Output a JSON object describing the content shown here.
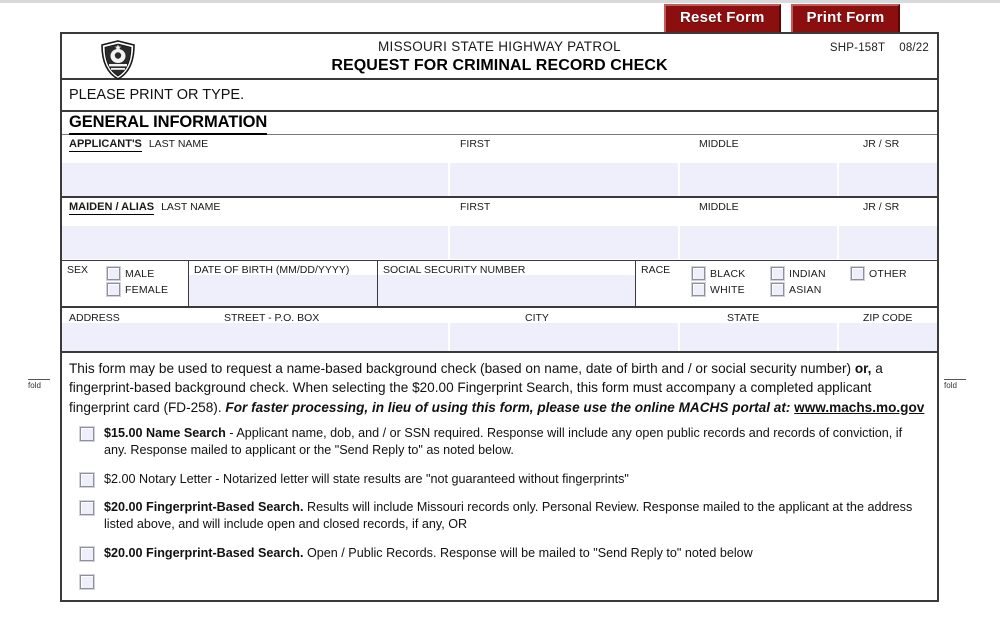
{
  "toolbar": {
    "reset_label": "Reset Form",
    "print_label": "Print Form",
    "button_color": "#8c0f10"
  },
  "header": {
    "seal_icon": "highway-patrol-shield-badge-icon",
    "organization": "MISSOURI STATE HIGHWAY PATROL",
    "title": "REQUEST FOR CRIMINAL RECORD CHECK",
    "form_number": "SHP-158T",
    "revision": "08/22"
  },
  "instructions_top": "PLEASE PRINT OR TYPE.",
  "general_information": {
    "section_title": "GENERAL INFORMATION",
    "applicant": {
      "owner_label": "APPLICANT'S",
      "last_name_label": "LAST NAME",
      "first_label": "FIRST",
      "middle_label": "MIDDLE",
      "suffix_label": "JR / SR",
      "last_name_value": "",
      "first_value": "",
      "middle_value": "",
      "suffix_value": ""
    },
    "maiden": {
      "owner_label": "MAIDEN / ALIAS",
      "last_name_label": "LAST NAME",
      "first_label": "FIRST",
      "middle_label": "MIDDLE",
      "suffix_label": "JR / SR",
      "last_name_value": "",
      "first_value": "",
      "middle_value": "",
      "suffix_value": ""
    },
    "sex": {
      "label": "SEX",
      "options": [
        "MALE",
        "FEMALE"
      ]
    },
    "dob": {
      "label": "DATE OF BIRTH (MM/DD/YYYY)",
      "value": ""
    },
    "ssn": {
      "label": "SOCIAL SECURITY NUMBER",
      "value": ""
    },
    "race": {
      "label": "RACE",
      "column1": [
        "BLACK",
        "WHITE"
      ],
      "column2": [
        "INDIAN",
        "ASIAN"
      ],
      "column3": [
        "OTHER"
      ]
    },
    "address": {
      "label": "ADDRESS",
      "street_label": "STREET - P.O. BOX",
      "city_label": "CITY",
      "state_label": "STATE",
      "zip_label": "ZIP CODE",
      "street_value": "",
      "city_value": "",
      "state_value": "",
      "zip_value": ""
    }
  },
  "fold_marks": {
    "left": "fold",
    "right": "fold"
  },
  "instructions": {
    "part1": "This form may be used to request a name-based background check (based on name, date of birth and / or social security number) ",
    "bold_or": "or,",
    "part2": " a fingerprint-based background check.  When selecting the $20.00 Fingerprint Search, this form must accompany a completed applicant fingerprint card (FD-258).  ",
    "italic": "For faster processing, in lieu of  using this form, please use the online MACHS portal at:  ",
    "link": "www.machs.mo.gov"
  },
  "options": [
    {
      "bold": "$15.00 Name Search",
      "rest": " - Applicant name, dob, and / or SSN required.  Response will include any open public records and records of conviction, if any.  Response mailed to applicant or the \"Send Reply to\" as noted below.",
      "checked": false
    },
    {
      "bold": "",
      "rest": "$2.00 Notary Letter - Notarized letter will state results are \"not guaranteed without fingerprints\"",
      "checked": false
    },
    {
      "bold": "$20.00 Fingerprint-Based Search.",
      "rest": "  Results will include Missouri records only.  Personal Review.  Response mailed to the applicant at the address listed above, and will include open and closed records, if any, OR",
      "checked": false
    },
    {
      "bold": "$20.00 Fingerprint-Based Search.",
      "rest": "  Open / Public Records.  Response will be mailed to \"Send Reply to\" noted below",
      "checked": false
    }
  ]
}
